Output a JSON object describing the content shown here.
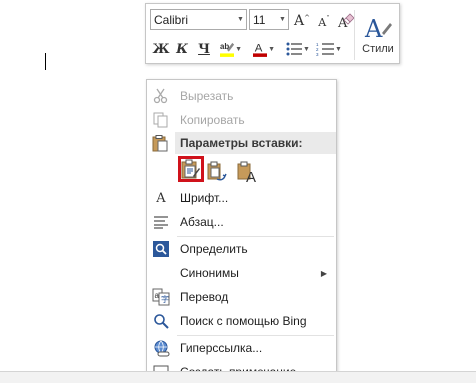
{
  "mini_toolbar": {
    "font_name": "Calibri",
    "font_size": "11",
    "grow_label": "A",
    "shrink_label": "A",
    "bold_label": "Ж",
    "italic_label": "К",
    "underline_label": "Ч",
    "highlight_color": "#ffff00",
    "font_color": "#c00000",
    "styles_label": "Стили",
    "accent_color": "#2b579a"
  },
  "context_menu": {
    "cut": "Вырезать",
    "copy": "Копировать",
    "paste_options_header": "Параметры вставки:",
    "font": "Шрифт...",
    "paragraph": "Абзац...",
    "define": "Определить",
    "synonyms": "Синонимы",
    "translate": "Перевод",
    "bing_search": "Поиск с помощью Bing",
    "hyperlink": "Гиперссылка...",
    "new_comment": "Создать примечание"
  },
  "paste_options": [
    {
      "name": "keep-source-formatting",
      "selected": true
    },
    {
      "name": "merge-formatting",
      "selected": false
    },
    {
      "name": "keep-text-only",
      "selected": false
    }
  ],
  "highlight_border_color": "#d0121b"
}
